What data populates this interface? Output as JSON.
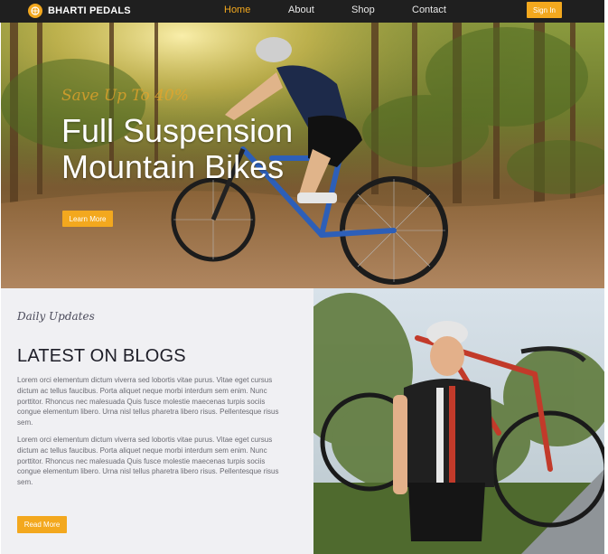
{
  "nav": {
    "brand": "BHARTI PEDALS",
    "links": [
      "Home",
      "About",
      "Shop",
      "Contact"
    ],
    "signin": "Sign In"
  },
  "hero": {
    "tagline": "Save Up To 40%",
    "title_line1": "Full Suspension",
    "title_line2": "Mountain Bikes",
    "button": "Learn More"
  },
  "blog": {
    "kicker": "Daily Updates",
    "heading": "LATEST ON BLOGS",
    "paragraph1": "Lorem orci elementum dictum viverra sed lobortis vitae purus. Vitae eget cursus dictum ac tellus faucibus. Porta aliquet neque morbi interdum sem enim. Nunc porttitor. Rhoncus nec malesuada Quis fusce molestie maecenas turpis sociis congue elementum libero. Urna nisl tellus pharetra libero risus. Pellentesque risus sem.",
    "paragraph2": "Lorem orci elementum dictum viverra sed lobortis vitae purus. Vitae eget cursus dictum ac tellus faucibus. Porta aliquet neque morbi interdum sem enim. Nunc porttitor. Rhoncus nec malesuada Quis fusce molestie maecenas turpis sociis congue elementum libero. Urna nisl tellus pharetra libero risus. Pellentesque risus sem.",
    "button": "Read More"
  },
  "colors": {
    "accent": "#f3a81e",
    "navbar": "#1f1f1f",
    "blog_bg": "#f0f0f3"
  },
  "icons": {
    "brand_logo": "bicycle-wheel-logo-icon"
  }
}
